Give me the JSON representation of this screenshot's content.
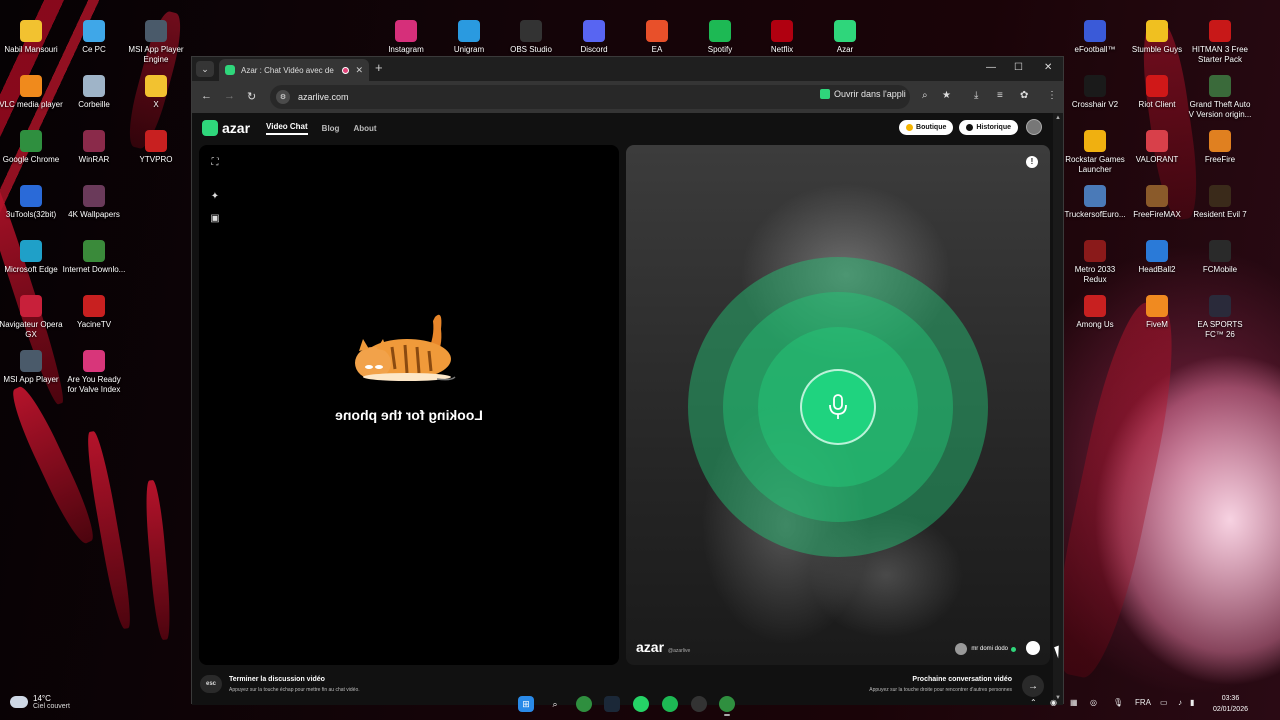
{
  "desktop": {
    "icons_left": [
      {
        "label": "Nabil Mansouri",
        "icon": "folder-icon",
        "color": "#f2c230"
      },
      {
        "label": "Ce PC",
        "icon": "monitor-icon",
        "color": "#3fa7e8"
      },
      {
        "label": "MSI App Player Engine",
        "icon": "msi-icon",
        "color": "#4a5a6a"
      },
      {
        "label": "VLC media player",
        "icon": "vlc-icon",
        "color": "#f08a1c"
      },
      {
        "label": "Corbeille",
        "icon": "trash-icon",
        "color": "#9fb4c8"
      },
      {
        "label": "X",
        "icon": "folder-icon",
        "color": "#f2c230"
      },
      {
        "label": "Google Chrome",
        "icon": "chrome-icon",
        "color": "#2f8f3f"
      },
      {
        "label": "WinRAR",
        "icon": "winrar-icon",
        "color": "#8a2a4a"
      },
      {
        "label": "YTVPRO",
        "icon": "ytvpro-icon",
        "color": "#c82020"
      },
      {
        "label": "3uTools(32bit)",
        "icon": "3utools-icon",
        "color": "#2a6ad8"
      },
      {
        "label": "4K Wallpapers",
        "icon": "wallpaper-icon",
        "color": "#6a3a5a"
      },
      {
        "label": "Microsoft Edge",
        "icon": "edge-icon",
        "color": "#1fa0c8"
      },
      {
        "label": "Internet Downlo...",
        "icon": "idm-icon",
        "color": "#3a8a3a"
      },
      {
        "label": "Navigateur Opera GX",
        "icon": "opera-gx-icon",
        "color": "#c8203a"
      },
      {
        "label": "YacineTV",
        "icon": "yacinetv-icon",
        "color": "#c82020"
      },
      {
        "label": "MSI App Player",
        "icon": "msi-icon",
        "color": "#4a5a6a"
      },
      {
        "label": "Are You Ready for Valve Index",
        "icon": "valve-icon",
        "color": "#d8367a"
      }
    ],
    "icons_top": [
      {
        "label": "Instagram",
        "icon": "instagram-icon",
        "color": "#d62f7a"
      },
      {
        "label": "Unigram",
        "icon": "telegram-icon",
        "color": "#2a9ae0"
      },
      {
        "label": "OBS Studio",
        "icon": "obs-icon",
        "color": "#333333"
      },
      {
        "label": "Discord",
        "icon": "discord-icon",
        "color": "#5865f2"
      },
      {
        "label": "EA",
        "icon": "ea-icon",
        "color": "#e8502a"
      },
      {
        "label": "Spotify",
        "icon": "spotify-icon",
        "color": "#1db954"
      },
      {
        "label": "Netflix",
        "icon": "netflix-icon",
        "color": "#b00010"
      },
      {
        "label": "Azar",
        "icon": "azar-icon",
        "color": "#2fd67b"
      }
    ],
    "icons_right": [
      {
        "label": "eFootball™",
        "icon": "efootball-icon",
        "color": "#3a5ad8"
      },
      {
        "label": "Stumble Guys",
        "icon": "stumble-guys-icon",
        "color": "#f0c020"
      },
      {
        "label": "HITMAN 3 Free Starter Pack",
        "icon": "hitman-icon",
        "color": "#c81818"
      },
      {
        "label": "Crosshair V2",
        "icon": "crosshair-icon",
        "color": "#1a1a1a"
      },
      {
        "label": "Riot Client",
        "icon": "riot-icon",
        "color": "#d01818"
      },
      {
        "label": "Grand Theft Auto V Version origin...",
        "icon": "gta-icon",
        "color": "#3a6a3a"
      },
      {
        "label": "Rockstar Games Launcher",
        "icon": "rockstar-icon",
        "color": "#f0b010"
      },
      {
        "label": "VALORANT",
        "icon": "valorant-icon",
        "color": "#d8404a"
      },
      {
        "label": "FreeFire",
        "icon": "freefire-icon",
        "color": "#e08020"
      },
      {
        "label": "TruckersofEuro...",
        "icon": "truckers-icon",
        "color": "#4a7ab8"
      },
      {
        "label": "FreeFireMAX",
        "icon": "freefiremax-icon",
        "color": "#8a5a2a"
      },
      {
        "label": "Resident Evil 7",
        "icon": "re7-icon",
        "color": "#3a2a1a"
      },
      {
        "label": "Metro 2033 Redux",
        "icon": "metro-icon",
        "color": "#8a1a1a"
      },
      {
        "label": "HeadBall2",
        "icon": "headball-icon",
        "color": "#2a7ad8"
      },
      {
        "label": "FCMobile",
        "icon": "fcmobile-icon",
        "color": "#2a2a2a"
      },
      {
        "label": "Among Us",
        "icon": "among-us-icon",
        "color": "#c82020"
      },
      {
        "label": "FiveM",
        "icon": "fivem-icon",
        "color": "#f08a20"
      },
      {
        "label": "EA SPORTS FC™ 26",
        "icon": "easfc-icon",
        "color": "#2a2a3a"
      }
    ]
  },
  "browser": {
    "tab": {
      "title": "Azar : Chat Vidéo avec de n",
      "close": "✕"
    },
    "new_tab": "+",
    "window_controls": {
      "minimize": "—",
      "maximize": "☐",
      "close": "✕"
    },
    "nav": {
      "back": "←",
      "forward": "→",
      "reload": "↻"
    },
    "url": "azarlive.com",
    "open_app": "Ouvrir dans l'appli"
  },
  "page": {
    "logo": "azar",
    "nav_links": [
      "Video Chat",
      "Blog",
      "About"
    ],
    "boutique": "Boutique",
    "historique": "Historique",
    "looking_text": "Looking for the phone",
    "report": "!",
    "right_logo": "azar",
    "right_logo_sub": "@azarlive",
    "user_name": "mr domi dodo",
    "bottom": {
      "esc": "esc",
      "end_title": "Terminer la discussion vidéo",
      "end_desc": "Appuyez sur la touche échap pour mettre fin au chat vidéo.",
      "next_title": "Prochaine conversation vidéo",
      "next_desc": "Appuyez sur la touche droite pour rencontrer d'autres personnes",
      "next_arrow": "→"
    }
  },
  "taskbar": {
    "temp": "14°C",
    "condition": "Ciel couvert",
    "lang": "FRA",
    "time": "03:36",
    "date": "02/01/2026"
  }
}
